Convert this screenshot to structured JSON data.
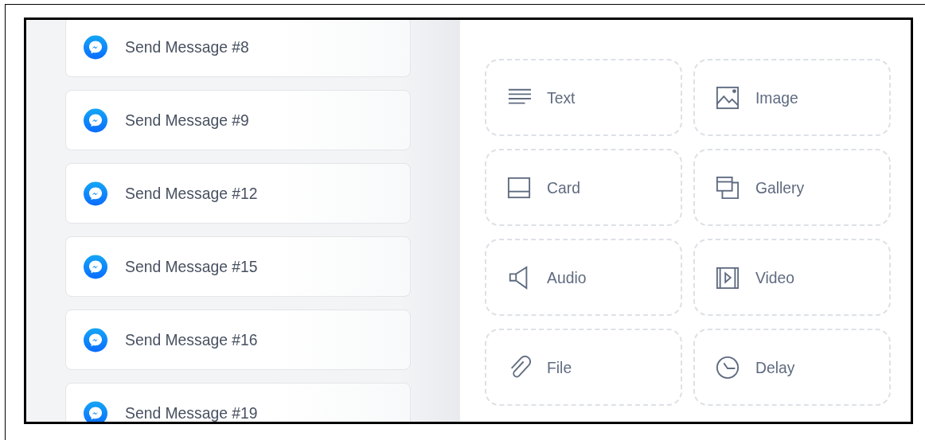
{
  "messages": [
    {
      "label": "Send Message #8"
    },
    {
      "label": "Send Message #9"
    },
    {
      "label": "Send Message #12"
    },
    {
      "label": "Send Message #15"
    },
    {
      "label": "Send Message #16"
    },
    {
      "label": "Send Message #19"
    }
  ],
  "blocks": [
    {
      "kind": "text",
      "label": "Text"
    },
    {
      "kind": "image",
      "label": "Image"
    },
    {
      "kind": "card",
      "label": "Card"
    },
    {
      "kind": "gallery",
      "label": "Gallery"
    },
    {
      "kind": "audio",
      "label": "Audio"
    },
    {
      "kind": "video",
      "label": "Video"
    },
    {
      "kind": "file",
      "label": "File"
    },
    {
      "kind": "delay",
      "label": "Delay"
    }
  ]
}
